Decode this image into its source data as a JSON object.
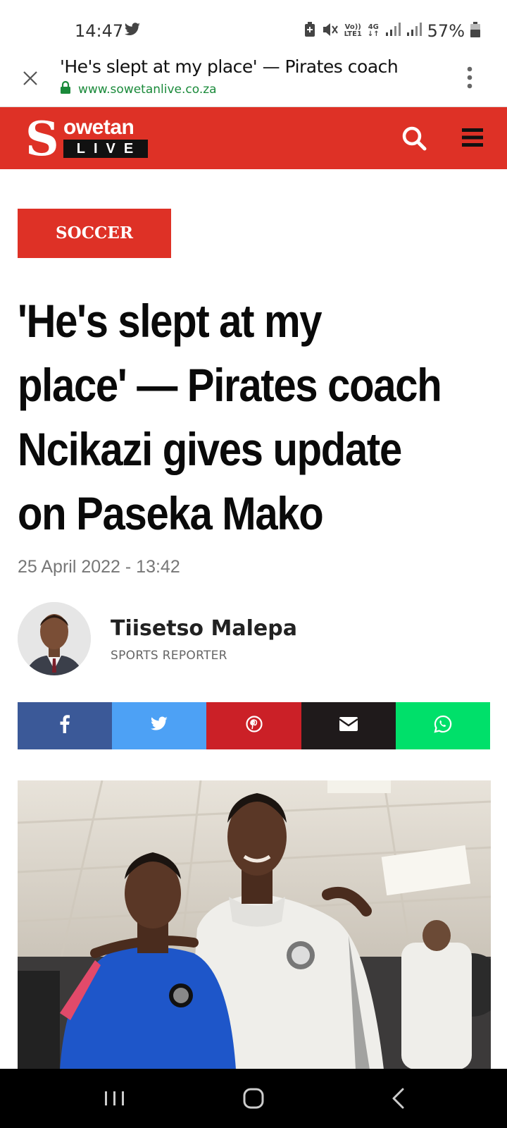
{
  "status_bar": {
    "time": "14:47",
    "network_top": "Vo))",
    "network_bottom": "LTE1",
    "data_top": "4G",
    "data_bottom": "↓↑",
    "battery": "57%"
  },
  "tab": {
    "title": "'He's slept at my place' — Pirates coach",
    "url": "www.sowetanlive.co.za"
  },
  "site": {
    "logo_s": "S",
    "logo_word": "owetan",
    "logo_live": "LIVE",
    "brand_color": "#de3126"
  },
  "article": {
    "category": "SOCCER",
    "headline_lines": [
      "'He's slept at my",
      "place' — Pirates coach",
      "Ncikazi gives update",
      "on Paseka Mako"
    ],
    "date": "25 April 2022 - 13:42",
    "author_name": "Tiisetso Malepa",
    "author_role": "SPORTS REPORTER"
  },
  "share": [
    {
      "name": "facebook",
      "color": "#3b5998",
      "icon": "facebook-icon"
    },
    {
      "name": "twitter",
      "color": "#4da1f5",
      "icon": "twitter-icon"
    },
    {
      "name": "pinterest",
      "color": "#cb2027",
      "icon": "pinterest-icon"
    },
    {
      "name": "email",
      "color": "#1f1a1b",
      "icon": "envelope-icon"
    },
    {
      "name": "whatsapp",
      "color": "#00e06a",
      "icon": "whatsapp-icon"
    }
  ]
}
